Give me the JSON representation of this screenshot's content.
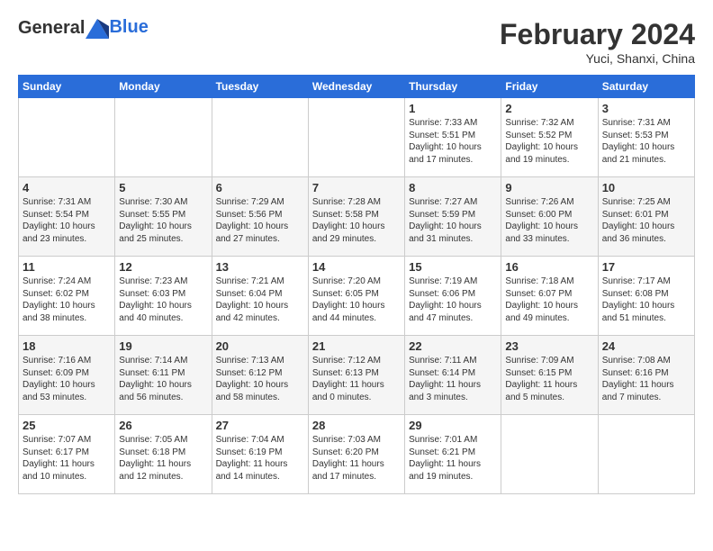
{
  "header": {
    "logo_line1": "General",
    "logo_line2": "Blue",
    "month_title": "February 2024",
    "subtitle": "Yuci, Shanxi, China"
  },
  "days_of_week": [
    "Sunday",
    "Monday",
    "Tuesday",
    "Wednesday",
    "Thursday",
    "Friday",
    "Saturday"
  ],
  "weeks": [
    [
      {
        "day": "",
        "detail": ""
      },
      {
        "day": "",
        "detail": ""
      },
      {
        "day": "",
        "detail": ""
      },
      {
        "day": "",
        "detail": ""
      },
      {
        "day": "1",
        "detail": "Sunrise: 7:33 AM\nSunset: 5:51 PM\nDaylight: 10 hours\nand 17 minutes."
      },
      {
        "day": "2",
        "detail": "Sunrise: 7:32 AM\nSunset: 5:52 PM\nDaylight: 10 hours\nand 19 minutes."
      },
      {
        "day": "3",
        "detail": "Sunrise: 7:31 AM\nSunset: 5:53 PM\nDaylight: 10 hours\nand 21 minutes."
      }
    ],
    [
      {
        "day": "4",
        "detail": "Sunrise: 7:31 AM\nSunset: 5:54 PM\nDaylight: 10 hours\nand 23 minutes."
      },
      {
        "day": "5",
        "detail": "Sunrise: 7:30 AM\nSunset: 5:55 PM\nDaylight: 10 hours\nand 25 minutes."
      },
      {
        "day": "6",
        "detail": "Sunrise: 7:29 AM\nSunset: 5:56 PM\nDaylight: 10 hours\nand 27 minutes."
      },
      {
        "day": "7",
        "detail": "Sunrise: 7:28 AM\nSunset: 5:58 PM\nDaylight: 10 hours\nand 29 minutes."
      },
      {
        "day": "8",
        "detail": "Sunrise: 7:27 AM\nSunset: 5:59 PM\nDaylight: 10 hours\nand 31 minutes."
      },
      {
        "day": "9",
        "detail": "Sunrise: 7:26 AM\nSunset: 6:00 PM\nDaylight: 10 hours\nand 33 minutes."
      },
      {
        "day": "10",
        "detail": "Sunrise: 7:25 AM\nSunset: 6:01 PM\nDaylight: 10 hours\nand 36 minutes."
      }
    ],
    [
      {
        "day": "11",
        "detail": "Sunrise: 7:24 AM\nSunset: 6:02 PM\nDaylight: 10 hours\nand 38 minutes."
      },
      {
        "day": "12",
        "detail": "Sunrise: 7:23 AM\nSunset: 6:03 PM\nDaylight: 10 hours\nand 40 minutes."
      },
      {
        "day": "13",
        "detail": "Sunrise: 7:21 AM\nSunset: 6:04 PM\nDaylight: 10 hours\nand 42 minutes."
      },
      {
        "day": "14",
        "detail": "Sunrise: 7:20 AM\nSunset: 6:05 PM\nDaylight: 10 hours\nand 44 minutes."
      },
      {
        "day": "15",
        "detail": "Sunrise: 7:19 AM\nSunset: 6:06 PM\nDaylight: 10 hours\nand 47 minutes."
      },
      {
        "day": "16",
        "detail": "Sunrise: 7:18 AM\nSunset: 6:07 PM\nDaylight: 10 hours\nand 49 minutes."
      },
      {
        "day": "17",
        "detail": "Sunrise: 7:17 AM\nSunset: 6:08 PM\nDaylight: 10 hours\nand 51 minutes."
      }
    ],
    [
      {
        "day": "18",
        "detail": "Sunrise: 7:16 AM\nSunset: 6:09 PM\nDaylight: 10 hours\nand 53 minutes."
      },
      {
        "day": "19",
        "detail": "Sunrise: 7:14 AM\nSunset: 6:11 PM\nDaylight: 10 hours\nand 56 minutes."
      },
      {
        "day": "20",
        "detail": "Sunrise: 7:13 AM\nSunset: 6:12 PM\nDaylight: 10 hours\nand 58 minutes."
      },
      {
        "day": "21",
        "detail": "Sunrise: 7:12 AM\nSunset: 6:13 PM\nDaylight: 11 hours\nand 0 minutes."
      },
      {
        "day": "22",
        "detail": "Sunrise: 7:11 AM\nSunset: 6:14 PM\nDaylight: 11 hours\nand 3 minutes."
      },
      {
        "day": "23",
        "detail": "Sunrise: 7:09 AM\nSunset: 6:15 PM\nDaylight: 11 hours\nand 5 minutes."
      },
      {
        "day": "24",
        "detail": "Sunrise: 7:08 AM\nSunset: 6:16 PM\nDaylight: 11 hours\nand 7 minutes."
      }
    ],
    [
      {
        "day": "25",
        "detail": "Sunrise: 7:07 AM\nSunset: 6:17 PM\nDaylight: 11 hours\nand 10 minutes."
      },
      {
        "day": "26",
        "detail": "Sunrise: 7:05 AM\nSunset: 6:18 PM\nDaylight: 11 hours\nand 12 minutes."
      },
      {
        "day": "27",
        "detail": "Sunrise: 7:04 AM\nSunset: 6:19 PM\nDaylight: 11 hours\nand 14 minutes."
      },
      {
        "day": "28",
        "detail": "Sunrise: 7:03 AM\nSunset: 6:20 PM\nDaylight: 11 hours\nand 17 minutes."
      },
      {
        "day": "29",
        "detail": "Sunrise: 7:01 AM\nSunset: 6:21 PM\nDaylight: 11 hours\nand 19 minutes."
      },
      {
        "day": "",
        "detail": ""
      },
      {
        "day": "",
        "detail": ""
      }
    ]
  ]
}
